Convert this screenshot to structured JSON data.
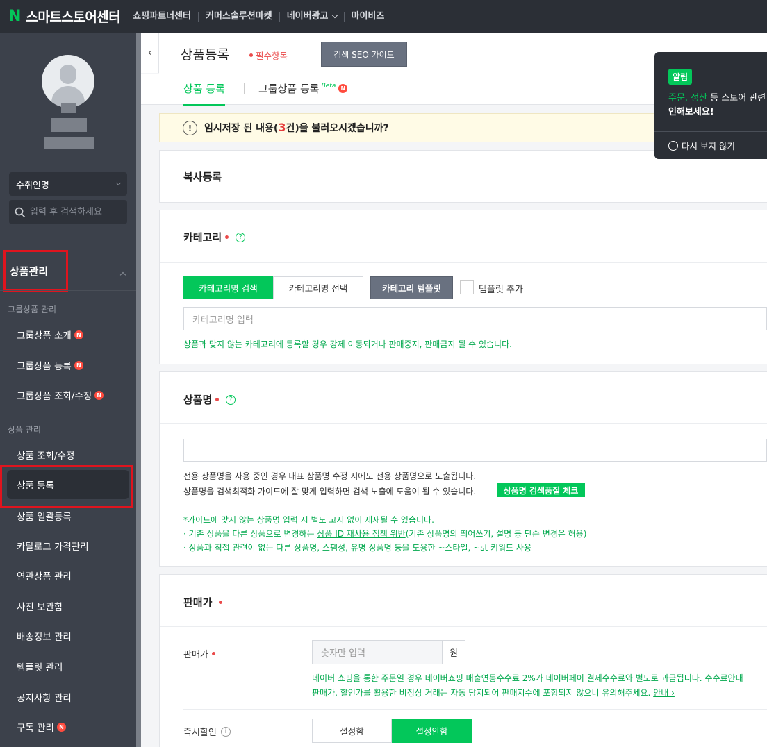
{
  "header": {
    "logo_mark": "N",
    "logo_text": "스마트스토어센터",
    "nav": [
      "쇼핑파트너센터",
      "커머스솔루션마켓",
      "네이버광고",
      "마이비즈"
    ]
  },
  "sidebar": {
    "store_name": "수취인명",
    "search_placeholder": "입력 후 검색하세요",
    "group_title": "상품관리",
    "section_group": "그룹상품 관리",
    "group_items": [
      {
        "label": "그룹상품 소개",
        "new": "N"
      },
      {
        "label": "그룹상품 등록",
        "new": "N"
      },
      {
        "label": "그룹상품 조회/수정",
        "new": "N"
      }
    ],
    "section_product": "상품 관리",
    "product_items": [
      {
        "label": "상품 조회/수정"
      },
      {
        "label": "상품 등록"
      },
      {
        "label": "상품 일괄등록"
      },
      {
        "label": "카탈로그 가격관리"
      },
      {
        "label": "연관상품 관리"
      },
      {
        "label": "사진 보관함"
      },
      {
        "label": "배송정보 관리"
      },
      {
        "label": "템플릿 관리"
      },
      {
        "label": "공지사항 관리"
      },
      {
        "label": "구독 관리",
        "new": "N"
      }
    ]
  },
  "page": {
    "collapse_glyph": "‹",
    "title": "상품등록",
    "required_label": "필수항목",
    "seo_button": "검색 SEO 가이드",
    "tabs": [
      {
        "label": "상품 등록"
      },
      {
        "label": "그룹상품 등록",
        "beta": "Beta",
        "new": "N"
      }
    ]
  },
  "notice": {
    "icon": "!",
    "text_before": "임시저장 된 내용(",
    "count": "3",
    "text_after": "건)을 불러오시겠습니까?"
  },
  "copy_section": {
    "title": "복사등록"
  },
  "category": {
    "title": "카테고리",
    "help": "?",
    "btn_search": "카테고리명 검색",
    "btn_select": "카테고리명 선택",
    "btn_template": "카테고리 템플릿",
    "template_add": "템플릿 추가",
    "input_placeholder": "카테고리명 입력",
    "warning": "상품과 맞지 않는 카테고리에 등록할 경우 강제 이동되거나 판매중지, 판매금지 될 수 있습니다."
  },
  "product_name": {
    "title": "상품명",
    "help": "?",
    "note1": "전용 상품명을 사용 중인 경우 대표 상품명 수정 시에도 전용 상품명으로 노출됩니다.",
    "note2": "상품명을 검색최적화 가이드에 잘 맞게 입력하면 검색 노출에 도움이 될 수 있습니다.",
    "check_button": "상품명 검색품질 체크",
    "guide1": "*가이드에 맞지 않는 상품명 입력 시 별도 고지 없이 제재될 수 있습니다.",
    "guide2_a": "· 기존 상품을 다른 상품으로 변경하는 ",
    "guide2_link": "상품 ID 재사용 정책 위반",
    "guide2_b": "(기존 상품명의 띄어쓰기, 설명 등 단순 변경은 허용)",
    "guide3": "· 상품과 직접 관련이 없는 다른 상품명, 스팸성, 유명 상품명 등을 도용한 ~스타일, ~st 키워드 사용"
  },
  "price": {
    "title": "판매가",
    "field_label": "판매가",
    "input_placeholder": "숫자만 입력",
    "unit": "원",
    "note1": "네이버 쇼핑을 통한 주문일 경우 네이버쇼핑 매출연동수수료 2%가 네이버페이 결제수수료와 별도로 과금됩니다. ",
    "note1_link": "수수료안내",
    "note2": "판매가, 할인가를 활용한 비정상 거래는 자동 탐지되어 판매지수에 포함되지 않으니 유의해주세요. ",
    "note2_link": "안내 ›",
    "discount_label": "즉시할인",
    "discount_info": "i",
    "discount_on": "설정함",
    "discount_off": "설정안함"
  },
  "alert": {
    "badge": "알림",
    "line1_hl1": "주문",
    "line1_sep": ", ",
    "line1_hl2": "정산",
    "line1_rest": " 등 스토어 관련",
    "line2": "인해보세요!",
    "dont_show": "다시 보지 않기"
  },
  "colors": {
    "accent": "#03c75a",
    "required": "#ea4a4a",
    "sidebar": "#3c414b",
    "topbar": "#2b2f36"
  }
}
